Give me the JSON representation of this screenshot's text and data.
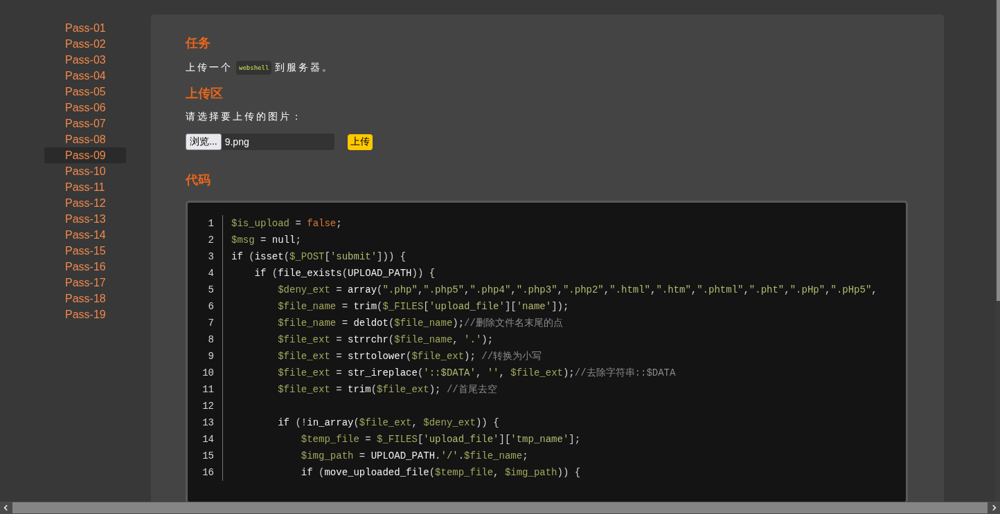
{
  "sidebar": {
    "items": [
      {
        "label": "Pass-01",
        "selected": false
      },
      {
        "label": "Pass-02",
        "selected": false
      },
      {
        "label": "Pass-03",
        "selected": false
      },
      {
        "label": "Pass-04",
        "selected": false
      },
      {
        "label": "Pass-05",
        "selected": false
      },
      {
        "label": "Pass-06",
        "selected": false
      },
      {
        "label": "Pass-07",
        "selected": false
      },
      {
        "label": "Pass-08",
        "selected": false
      },
      {
        "label": "Pass-09",
        "selected": true
      },
      {
        "label": "Pass-10",
        "selected": false
      },
      {
        "label": "Pass-11",
        "selected": false
      },
      {
        "label": "Pass-12",
        "selected": false
      },
      {
        "label": "Pass-13",
        "selected": false
      },
      {
        "label": "Pass-14",
        "selected": false
      },
      {
        "label": "Pass-15",
        "selected": false
      },
      {
        "label": "Pass-16",
        "selected": false
      },
      {
        "label": "Pass-17",
        "selected": false
      },
      {
        "label": "Pass-18",
        "selected": false
      },
      {
        "label": "Pass-19",
        "selected": false
      }
    ]
  },
  "task": {
    "heading": "任务",
    "text_before": "上传一个",
    "code": "webshell",
    "text_after": "到服务器。"
  },
  "upload": {
    "heading": "上传区",
    "prompt": "请选择要上传的图片：",
    "browse_button": "浏览...",
    "file_name": "9.png",
    "submit_button": "上传"
  },
  "code": {
    "heading": "代码",
    "lines": [
      {
        "number": "1",
        "tokens": [
          {
            "kind": "var",
            "text": "$is_upload"
          },
          {
            "kind": "punct",
            "text": " = "
          },
          {
            "kind": "const",
            "text": "false"
          },
          {
            "kind": "punct",
            "text": ";"
          }
        ]
      },
      {
        "number": "2",
        "tokens": [
          {
            "kind": "var",
            "text": "$msg"
          },
          {
            "kind": "punct",
            "text": " = "
          },
          {
            "kind": "keyword",
            "text": "null"
          },
          {
            "kind": "punct",
            "text": ";"
          }
        ]
      },
      {
        "number": "3",
        "tokens": [
          {
            "kind": "keyword",
            "text": "if"
          },
          {
            "kind": "punct",
            "text": " ("
          },
          {
            "kind": "func",
            "text": "isset"
          },
          {
            "kind": "punct",
            "text": "("
          },
          {
            "kind": "var",
            "text": "$_POST"
          },
          {
            "kind": "punct",
            "text": "["
          },
          {
            "kind": "string",
            "text": "'submit'"
          },
          {
            "kind": "punct",
            "text": "])) {"
          }
        ]
      },
      {
        "number": "4",
        "tokens": [
          {
            "kind": "keyword",
            "text": "    if"
          },
          {
            "kind": "punct",
            "text": " ("
          },
          {
            "kind": "func",
            "text": "file_exists"
          },
          {
            "kind": "punct",
            "text": "("
          },
          {
            "kind": "keyword",
            "text": "UPLOAD_PATH"
          },
          {
            "kind": "punct",
            "text": ")) {"
          }
        ]
      },
      {
        "number": "5",
        "tokens": [
          {
            "kind": "var",
            "text": "        $deny_ext"
          },
          {
            "kind": "punct",
            "text": " = "
          },
          {
            "kind": "func",
            "text": "array"
          },
          {
            "kind": "punct",
            "text": "("
          },
          {
            "kind": "string",
            "text": "\".php\""
          },
          {
            "kind": "punct",
            "text": ","
          },
          {
            "kind": "string",
            "text": "\".php5\""
          },
          {
            "kind": "punct",
            "text": ","
          },
          {
            "kind": "string",
            "text": "\".php4\""
          },
          {
            "kind": "punct",
            "text": ","
          },
          {
            "kind": "string",
            "text": "\".php3\""
          },
          {
            "kind": "punct",
            "text": ","
          },
          {
            "kind": "string",
            "text": "\".php2\""
          },
          {
            "kind": "punct",
            "text": ","
          },
          {
            "kind": "string",
            "text": "\".html\""
          },
          {
            "kind": "punct",
            "text": ","
          },
          {
            "kind": "string",
            "text": "\".htm\""
          },
          {
            "kind": "punct",
            "text": ","
          },
          {
            "kind": "string",
            "text": "\".phtml\""
          },
          {
            "kind": "punct",
            "text": ","
          },
          {
            "kind": "string",
            "text": "\".pht\""
          },
          {
            "kind": "punct",
            "text": ","
          },
          {
            "kind": "string",
            "text": "\".pHp\""
          },
          {
            "kind": "punct",
            "text": ","
          },
          {
            "kind": "string",
            "text": "\".pHp5\""
          },
          {
            "kind": "punct",
            "text": ","
          }
        ]
      },
      {
        "number": "6",
        "tokens": [
          {
            "kind": "var",
            "text": "        $file_name"
          },
          {
            "kind": "punct",
            "text": " = "
          },
          {
            "kind": "func",
            "text": "trim"
          },
          {
            "kind": "punct",
            "text": "("
          },
          {
            "kind": "var",
            "text": "$_FILES"
          },
          {
            "kind": "punct",
            "text": "["
          },
          {
            "kind": "string",
            "text": "'upload_file'"
          },
          {
            "kind": "punct",
            "text": "]["
          },
          {
            "kind": "string",
            "text": "'name'"
          },
          {
            "kind": "punct",
            "text": "]);"
          }
        ]
      },
      {
        "number": "7",
        "tokens": [
          {
            "kind": "var",
            "text": "        $file_name"
          },
          {
            "kind": "punct",
            "text": " = "
          },
          {
            "kind": "func",
            "text": "deldot"
          },
          {
            "kind": "punct",
            "text": "("
          },
          {
            "kind": "var",
            "text": "$file_name"
          },
          {
            "kind": "punct",
            "text": ");"
          },
          {
            "kind": "comment",
            "text": "//删除文件名末尾的点"
          }
        ]
      },
      {
        "number": "8",
        "tokens": [
          {
            "kind": "var",
            "text": "        $file_ext"
          },
          {
            "kind": "punct",
            "text": " = "
          },
          {
            "kind": "func",
            "text": "strrchr"
          },
          {
            "kind": "punct",
            "text": "("
          },
          {
            "kind": "var",
            "text": "$file_name"
          },
          {
            "kind": "punct",
            "text": ", "
          },
          {
            "kind": "string",
            "text": "'.'"
          },
          {
            "kind": "punct",
            "text": ");"
          }
        ]
      },
      {
        "number": "9",
        "tokens": [
          {
            "kind": "var",
            "text": "        $file_ext"
          },
          {
            "kind": "punct",
            "text": " = "
          },
          {
            "kind": "func",
            "text": "strtolower"
          },
          {
            "kind": "punct",
            "text": "("
          },
          {
            "kind": "var",
            "text": "$file_ext"
          },
          {
            "kind": "punct",
            "text": "); "
          },
          {
            "kind": "comment",
            "text": "//转换为小写"
          }
        ]
      },
      {
        "number": "10",
        "tokens": [
          {
            "kind": "var",
            "text": "        $file_ext"
          },
          {
            "kind": "punct",
            "text": " = "
          },
          {
            "kind": "func",
            "text": "str_ireplace"
          },
          {
            "kind": "punct",
            "text": "("
          },
          {
            "kind": "string",
            "text": "'::$DATA'"
          },
          {
            "kind": "punct",
            "text": ", "
          },
          {
            "kind": "string",
            "text": "''"
          },
          {
            "kind": "punct",
            "text": ", "
          },
          {
            "kind": "var",
            "text": "$file_ext"
          },
          {
            "kind": "punct",
            "text": ");"
          },
          {
            "kind": "comment",
            "text": "//去除字符串::$DATA"
          }
        ]
      },
      {
        "number": "11",
        "tokens": [
          {
            "kind": "var",
            "text": "        $file_ext"
          },
          {
            "kind": "punct",
            "text": " = "
          },
          {
            "kind": "func",
            "text": "trim"
          },
          {
            "kind": "punct",
            "text": "("
          },
          {
            "kind": "var",
            "text": "$file_ext"
          },
          {
            "kind": "punct",
            "text": "); "
          },
          {
            "kind": "comment",
            "text": "//首尾去空"
          }
        ]
      },
      {
        "number": "12"
      },
      {
        "number": "13",
        "tokens": [
          {
            "kind": "keyword",
            "text": "        if"
          },
          {
            "kind": "punct",
            "text": " (!"
          },
          {
            "kind": "func",
            "text": "in_array"
          },
          {
            "kind": "punct",
            "text": "("
          },
          {
            "kind": "var",
            "text": "$file_ext"
          },
          {
            "kind": "punct",
            "text": ", "
          },
          {
            "kind": "var",
            "text": "$deny_ext"
          },
          {
            "kind": "punct",
            "text": ")) {"
          }
        ]
      },
      {
        "number": "14",
        "tokens": [
          {
            "kind": "var",
            "text": "            $temp_file"
          },
          {
            "kind": "punct",
            "text": " = "
          },
          {
            "kind": "var",
            "text": "$_FILES"
          },
          {
            "kind": "punct",
            "text": "["
          },
          {
            "kind": "string",
            "text": "'upload_file'"
          },
          {
            "kind": "punct",
            "text": "]["
          },
          {
            "kind": "string",
            "text": "'tmp_name'"
          },
          {
            "kind": "punct",
            "text": "];"
          }
        ]
      },
      {
        "number": "15",
        "tokens": [
          {
            "kind": "var",
            "text": "            $img_path"
          },
          {
            "kind": "punct",
            "text": " = "
          },
          {
            "kind": "keyword",
            "text": "UPLOAD_PATH"
          },
          {
            "kind": "punct",
            "text": "."
          },
          {
            "kind": "string",
            "text": "'/'"
          },
          {
            "kind": "punct",
            "text": "."
          },
          {
            "kind": "var",
            "text": "$file_name"
          },
          {
            "kind": "punct",
            "text": ";"
          }
        ]
      },
      {
        "number": "16",
        "tokens": [
          {
            "kind": "keyword",
            "text": "            if"
          },
          {
            "kind": "punct",
            "text": " ("
          },
          {
            "kind": "func",
            "text": "move_uploaded_file"
          },
          {
            "kind": "punct",
            "text": "("
          },
          {
            "kind": "var",
            "text": "$temp_file"
          },
          {
            "kind": "punct",
            "text": ", "
          },
          {
            "kind": "var",
            "text": "$img_path"
          },
          {
            "kind": "punct",
            "text": ")) {"
          }
        ]
      }
    ]
  }
}
